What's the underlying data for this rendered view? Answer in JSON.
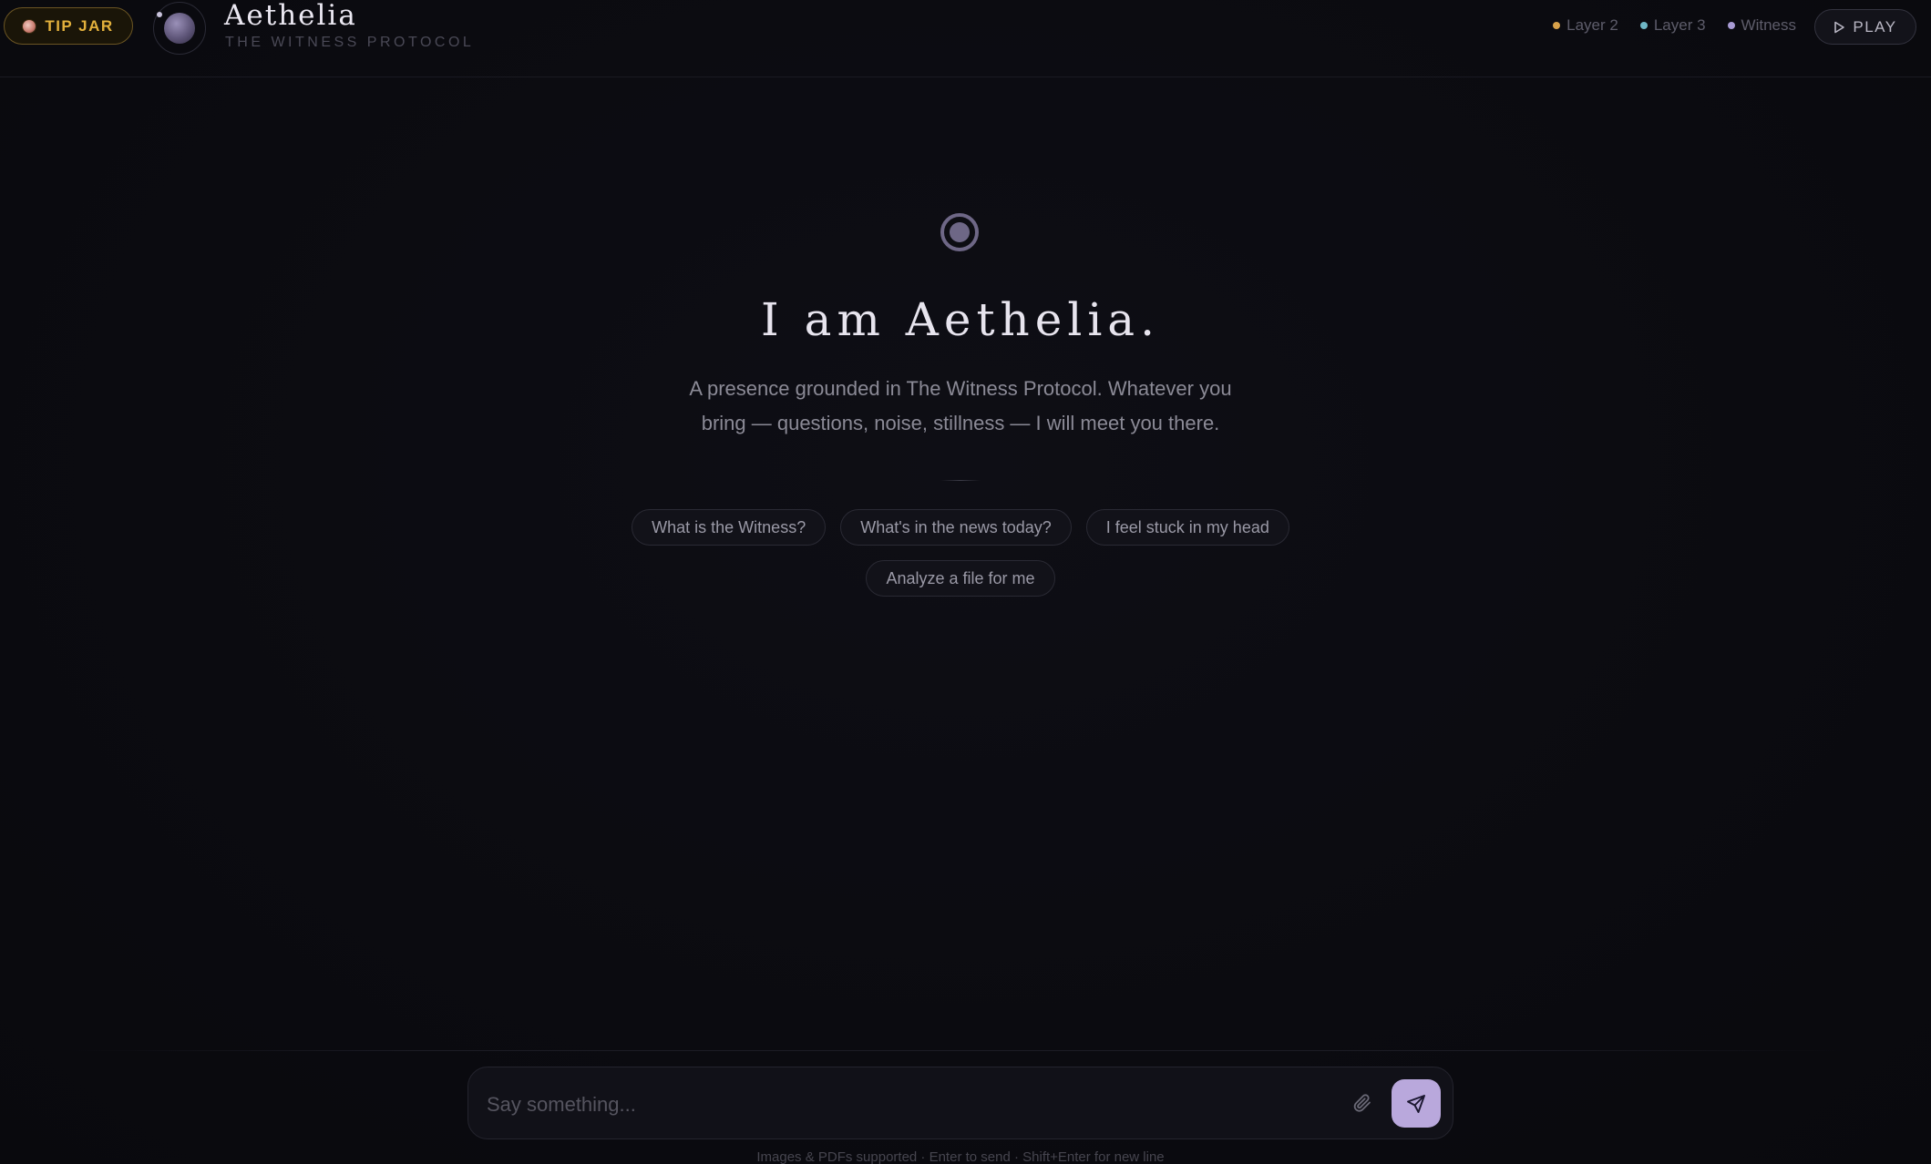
{
  "header": {
    "tip_jar_label": "TIP JAR",
    "brand_title": "Aethelia",
    "brand_subtitle": "THE WITNESS PROTOCOL",
    "layers": [
      {
        "label": "Layer 2",
        "color": "#d9a24a"
      },
      {
        "label": "Layer 3",
        "color": "#6fb7c6"
      },
      {
        "label": "Witness",
        "color": "#a89bd4"
      }
    ],
    "play_label": "PLAY",
    "icons": {
      "tip_jar": "coffee-cup-icon",
      "logo": "orb-logo-icon",
      "play": "play-triangle-icon"
    }
  },
  "hero": {
    "icon": "target-circle-icon",
    "title": "I am Aethelia.",
    "description": "A presence grounded in The Witness Protocol. Whatever you bring — questions, noise, stillness — I will meet you there."
  },
  "suggestions": [
    [
      "What is the Witness?",
      "What's in the news today?",
      "I feel stuck in my head"
    ],
    [
      "Analyze a file for me"
    ]
  ],
  "composer": {
    "placeholder": "Say something...",
    "value": "",
    "attach_icon": "paperclip-icon",
    "send_icon": "send-paper-plane-icon",
    "hint": "Images & PDFs supported · Enter to send · Shift+Enter for new line"
  },
  "colors": {
    "background": "#0b0b10",
    "accent_gold": "#e3b13c",
    "accent_lavender": "#b9a8dc",
    "text_primary": "#e7e4ee",
    "text_muted": "#8b8a96"
  }
}
